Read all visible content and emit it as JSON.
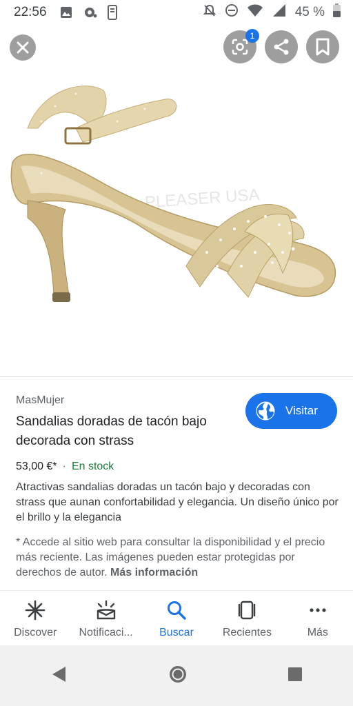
{
  "status_bar": {
    "time": "22:56",
    "battery": "45 %"
  },
  "image_viewer": {
    "lens_badge": "1",
    "watermark": "PLEASER USA"
  },
  "result": {
    "source": "MasMujer",
    "title": "Sandalias doradas de tacón bajo decorada con strass",
    "visit_label": "Visitar",
    "price": "53,00 €*",
    "separator": "·",
    "stock": "En stock",
    "description": "Atractivas sandalias doradas un tacón bajo y decoradas con strass que aunan confortabilidad y elegancia. Un diseño único por el brillo y la elegancia",
    "note": "* Accede al sitio web para consultar la disponibilidad y el precio más reciente. Las imágenes pueden estar protegidas por derechos de autor.",
    "note_link": "Más información"
  },
  "bottom_nav": {
    "items": [
      {
        "label": "Discover",
        "icon": "asterisk-icon"
      },
      {
        "label": "Notificaci...",
        "icon": "bell-icon"
      },
      {
        "label": "Buscar",
        "icon": "search-icon"
      },
      {
        "label": "Recientes",
        "icon": "recent-cards-icon"
      },
      {
        "label": "Más",
        "icon": "more-dots-icon"
      }
    ],
    "active": "Buscar"
  },
  "colors": {
    "accent": "#1a73e8",
    "stock": "#188038",
    "button_gray": "#9e9e9e"
  }
}
